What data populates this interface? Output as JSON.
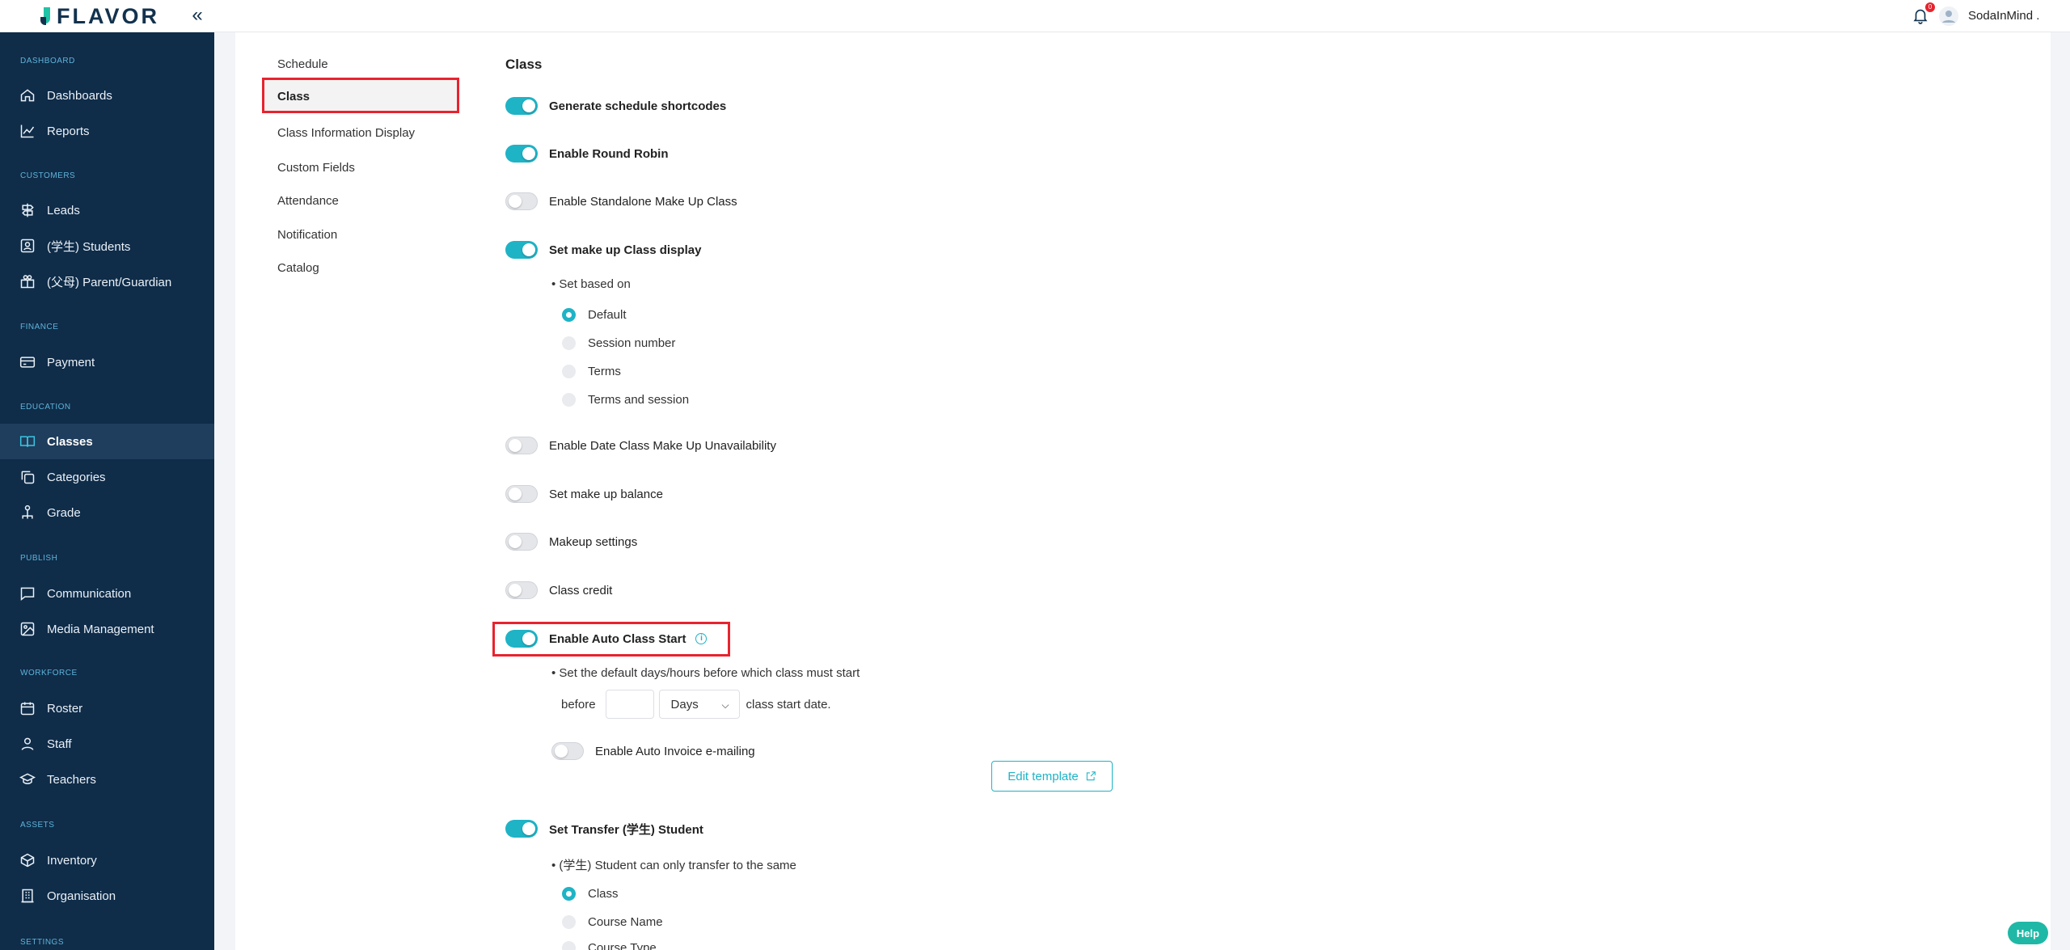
{
  "header": {
    "brand": "FLAVOR",
    "collapse_icon": "«",
    "notification_count": "0",
    "username": "SodaInMind ."
  },
  "sidebar": {
    "sections": {
      "dashboard": "DASHBOARD",
      "customers": "CUSTOMERS",
      "finance": "FINANCE",
      "education": "EDUCATION",
      "publish": "PUBLISH",
      "workforce": "WORKFORCE",
      "assets": "ASSETS",
      "settings": "SETTINGS"
    },
    "items": {
      "dashboards": "Dashboards",
      "reports": "Reports",
      "leads": "Leads",
      "students": "(学生) Students",
      "parent": "(父母) Parent/Guardian",
      "payment": "Payment",
      "classes": "Classes",
      "categories": "Categories",
      "grade": "Grade",
      "communication": "Communication",
      "media": "Media Management",
      "roster": "Roster",
      "staff": "Staff",
      "teachers": "Teachers",
      "inventory": "Inventory",
      "organisation": "Organisation"
    },
    "active_item": "Classes"
  },
  "subnav": {
    "schedule": "Schedule",
    "class": "Class",
    "class_info": "Class Information Display",
    "custom_fields": "Custom Fields",
    "attendance": "Attendance",
    "notification": "Notification",
    "catalog": "Catalog",
    "active": "Class"
  },
  "main": {
    "title": "Class",
    "settings": {
      "generate_shortcodes": {
        "label": "Generate schedule shortcodes",
        "on": true
      },
      "round_robin": {
        "label": "Enable Round Robin",
        "on": true
      },
      "standalone_makeup": {
        "label": "Enable Standalone Make Up Class",
        "on": false
      },
      "makeup_display": {
        "label": "Set make up Class display",
        "on": true
      },
      "date_unavailability": {
        "label": "Enable Date Class Make Up Unavailability",
        "on": false
      },
      "makeup_balance": {
        "label": "Set make up balance",
        "on": false
      },
      "makeup_settings": {
        "label": "Makeup settings",
        "on": false
      },
      "class_credit": {
        "label": "Class credit",
        "on": false
      },
      "auto_class_start": {
        "label": "Enable Auto Class Start",
        "on": true
      },
      "auto_invoice": {
        "label": "Enable Auto Invoice e-mailing",
        "on": false
      },
      "transfer_student": {
        "label": "Set Transfer (学生) Student",
        "on": true
      }
    },
    "set_based_on": {
      "label": "• Set based on",
      "options": [
        "Default",
        "Session number",
        "Terms",
        "Terms and session"
      ],
      "selected": "Default"
    },
    "auto_start": {
      "hint": "• Set the default days/hours before which class must start",
      "before": "before",
      "days_value": "",
      "unit": "Days",
      "after": "class start date."
    },
    "edit_template": "Edit template",
    "transfer": {
      "label": "• (学生) Student can only transfer to the same",
      "options": [
        "Class",
        "Course Name",
        "Course Type"
      ],
      "selected": "Class"
    }
  },
  "help": "Help"
}
